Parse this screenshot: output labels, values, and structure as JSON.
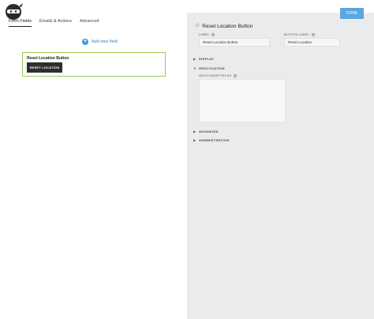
{
  "header": {
    "logo_icon": "ninja-forms-logo-icon",
    "done_label": "DONE",
    "accent_color": "#5aa6dd"
  },
  "tabs": [
    {
      "label": "Form Fields",
      "active": true
    },
    {
      "label": "Emails & Actions",
      "active": false
    },
    {
      "label": "Advanced",
      "active": false
    }
  ],
  "builder": {
    "add_field_icon": "plus-circle-icon",
    "add_field_label": "Add new field",
    "field_card": {
      "title": "Reset Location Button",
      "button_label": "RESET LOCATION",
      "border_color": "#9ccc4f"
    }
  },
  "settings": {
    "title_icon": "star-icon",
    "title": "Reset Location Button",
    "label_heading": "LABEL",
    "label_value": "Reset Location Button",
    "button_label_heading": "BUTTON LABEL",
    "button_label_value": "Reset Location",
    "sections": {
      "display": "DISPLAY",
      "geolocation": "GEOLOCATION",
      "geocoder_fields": "GEOCODER FIELDS",
      "advanced": "ADVANCED",
      "administration": "ADMINISTRATION"
    }
  }
}
